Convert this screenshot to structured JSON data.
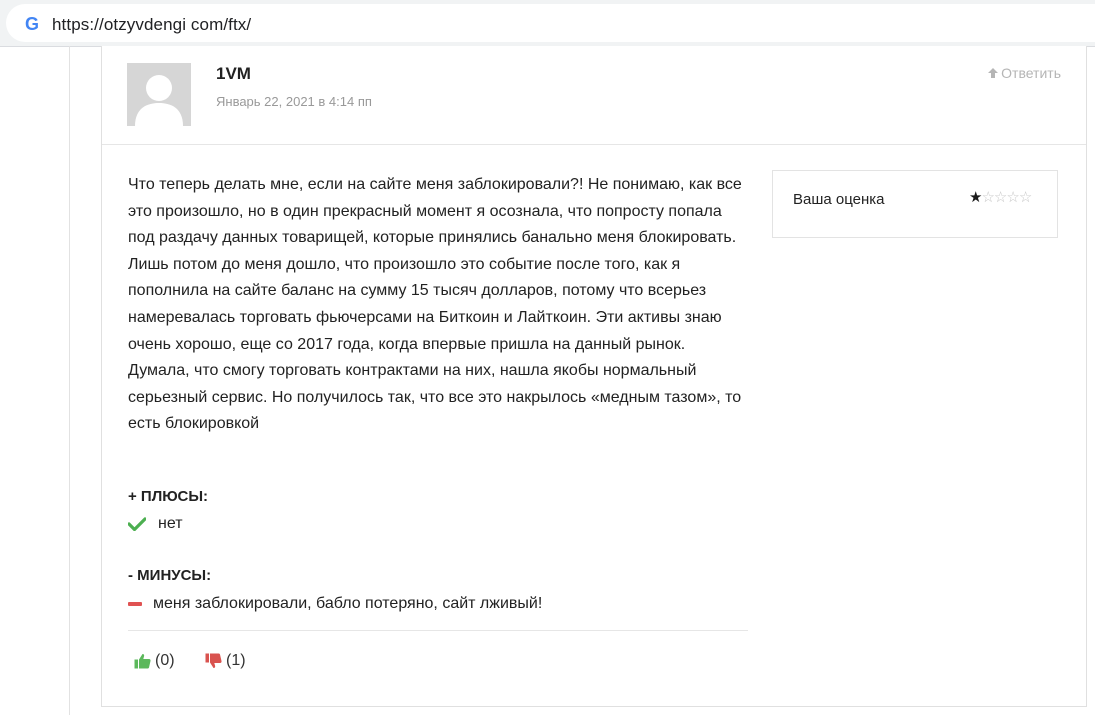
{
  "browser": {
    "url": "https://otzyvdengi com/ftx/",
    "favicon": "G"
  },
  "comment": {
    "author": "1VM",
    "date": "Январь 22, 2021 в 4:14 пп",
    "reply_label": "Ответить",
    "text": "Что теперь делать мне, если на сайте меня заблокировали?! Не понимаю, как все это произошло, но в один прекрасный момент я осознала, что попросту попала под раздачу данных товарищей, которые принялись банально меня блокировать. Лишь потом до меня дошло, что произошло это событие после того, как я пополнила на сайте баланс на сумму 15 тысяч долларов, потому что всерьез намеревалась торговать фьючерсами на Биткоин и Лайткоин. Эти активы знаю очень хорошо, еще со 2017 года, когда впервые пришла на данный рынок. Думала, что смогу торговать контрактами на них, нашла якобы нормальный серьезный сервис. Но получилось так, что все это накрылось «медным тазом», то есть блокировкой",
    "rating": {
      "label": "Ваша оценка",
      "value": 1,
      "max": 5
    },
    "pros": {
      "title": "+ ПЛЮСЫ:",
      "text": "нет"
    },
    "cons": {
      "title": "- МИНУСЫ:",
      "text": "меня заблокировали, бабло потеряно, сайт лживый!"
    },
    "votes": {
      "up": "(0)",
      "down": "(1)"
    }
  },
  "colors": {
    "check_green": "#4caf50",
    "minus_red": "#e05252",
    "thumb_up": "#5cb85c",
    "thumb_down": "#d9534f"
  },
  "icons": {
    "favicon": "google-icon",
    "reply": "arrow-up-icon",
    "pros": "check-icon",
    "cons": "minus-icon",
    "vote_up": "thumbs-up-icon",
    "vote_down": "thumbs-down-icon"
  }
}
